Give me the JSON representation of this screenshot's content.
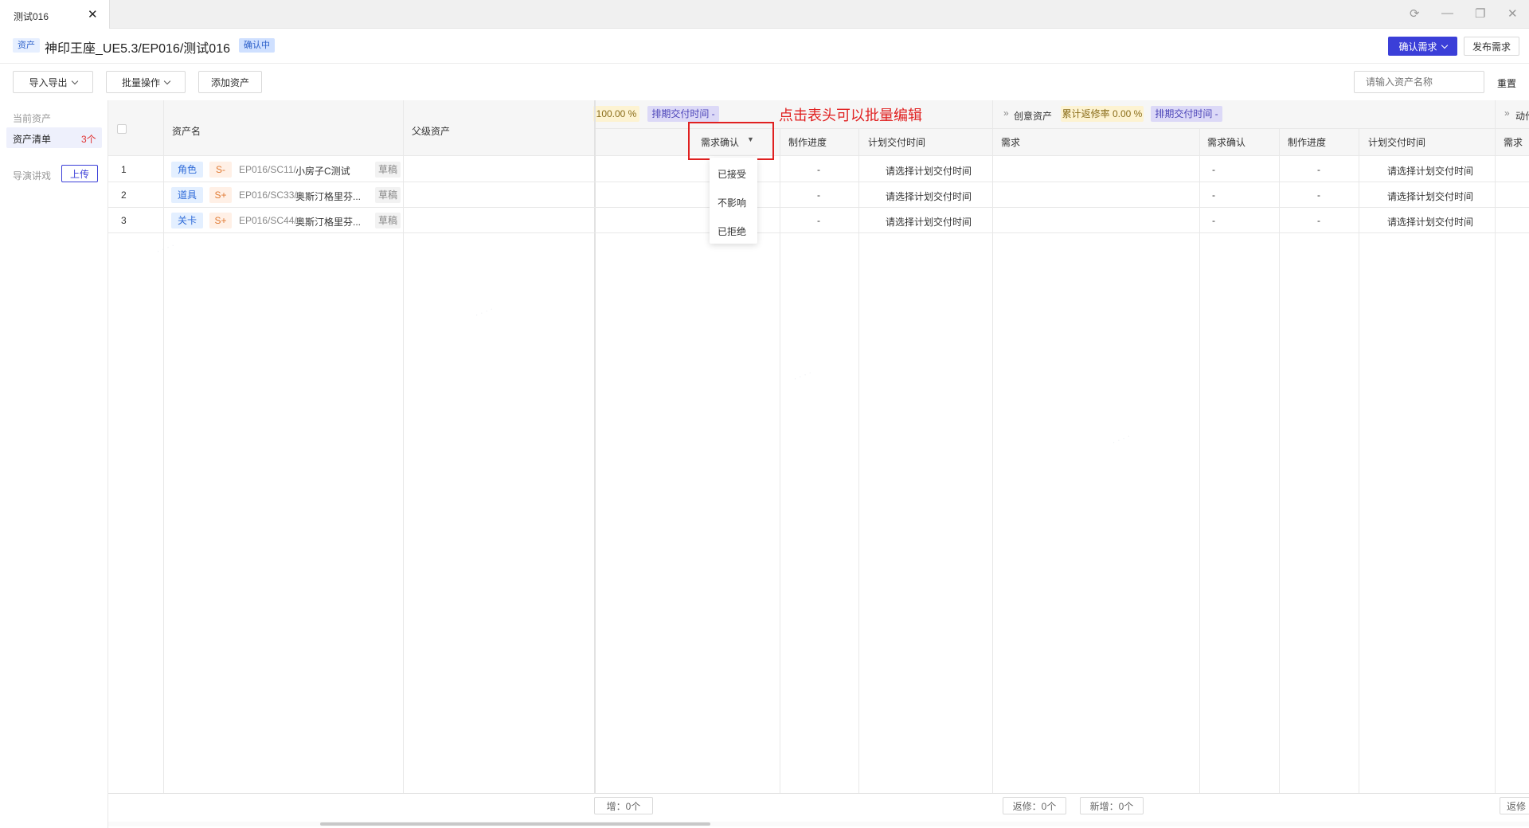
{
  "window": {
    "tab_title": "测试016",
    "tab_close": "✕"
  },
  "header": {
    "asset_tag": "资产",
    "title": "神印王座_UE5.3/EP016/测试016",
    "status": "确认中",
    "confirm_button": "确认需求",
    "publish_button": "发布需求"
  },
  "toolbar": {
    "import_export": "导入导出",
    "batch": "批量操作",
    "add_asset": "添加资产",
    "search_placeholder": "请输入资产名称",
    "reset": "重置"
  },
  "sidebar": {
    "current_assets": "当前资产",
    "asset_list": "资产清单",
    "asset_count": "3个",
    "director": "导演讲戏",
    "upload": "上传"
  },
  "table": {
    "col_asset_name": "资产名",
    "col_parent": "父级资产",
    "group1": {
      "rate": "100.00 %",
      "schedule": "排期交付时间 -"
    },
    "annotation": "点击表头可以批量编辑",
    "group2": {
      "name": "创意资产",
      "rate": "累计返修率 0.00 %",
      "schedule": "排期交付时间 -"
    },
    "group3_name": "动作",
    "sub_headers": {
      "confirm": "需求确认",
      "progress": "制作进度",
      "plan_time": "计划交付时间",
      "demand": "需求",
      "confirm2": "需求确认",
      "progress2": "制作进度",
      "plan_time2": "计划交付时间",
      "demand3": "需求"
    },
    "rows": [
      {
        "index": "1",
        "type": "角色",
        "grade": "S-",
        "path": "EP016/SC11/",
        "name": "小房子C测试",
        "draft": "草稿",
        "progress": "-",
        "plan": "请选择计划交付时间",
        "confirm2": "-",
        "progress2": "-",
        "plan2": "请选择计划交付时间"
      },
      {
        "index": "2",
        "type": "道具",
        "grade": "S+",
        "path": "EP016/SC33/",
        "name": "奥斯汀格里芬...",
        "draft": "草稿",
        "progress": "-",
        "plan": "请选择计划交付时间",
        "confirm2": "-",
        "progress2": "-",
        "plan2": "请选择计划交付时间"
      },
      {
        "index": "3",
        "type": "关卡",
        "grade": "S+",
        "path": "EP016/SC44/",
        "name": "奥斯汀格里芬...",
        "draft": "草稿",
        "progress": "-",
        "plan": "请选择计划交付时间",
        "confirm2": "-",
        "progress2": "-",
        "plan2": "请选择计划交付时间"
      }
    ],
    "dropdown_options": [
      "已接受",
      "不影响",
      "已拒绝"
    ],
    "footer": {
      "new1": "增：0个",
      "repair2": "返修：0个",
      "new2": "新增：0个",
      "repair3": "返修"
    }
  },
  "colors": {
    "accent": "#3b3fd8",
    "annotation_red": "#e02020",
    "tag_blue_bg": "#e3efff",
    "tag_orange_bg": "#fff0e6"
  }
}
